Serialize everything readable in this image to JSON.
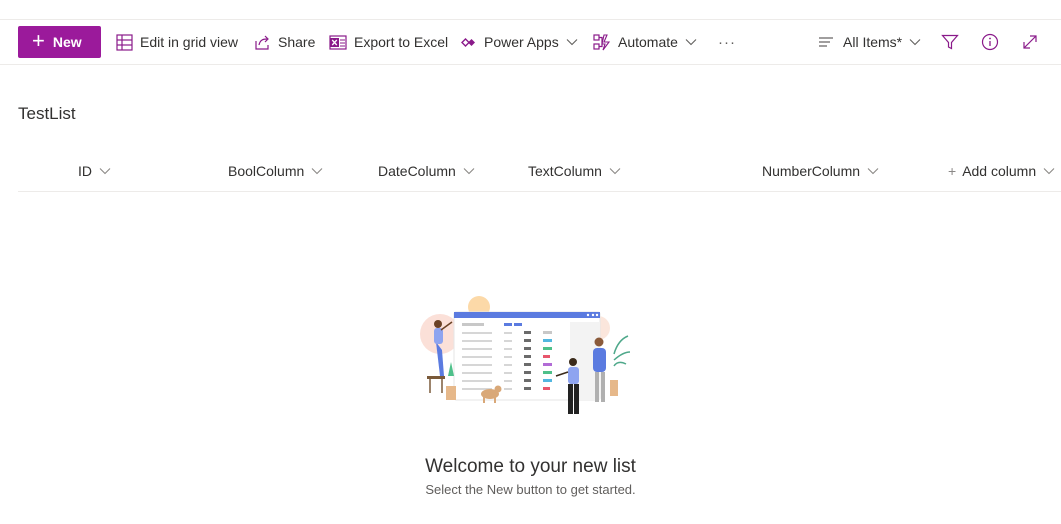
{
  "command_bar": {
    "new_label": "New",
    "edit_grid_label": "Edit in grid view",
    "share_label": "Share",
    "export_label": "Export to Excel",
    "power_apps_label": "Power Apps",
    "automate_label": "Automate",
    "more_label": "···",
    "view_label": "All Items*"
  },
  "list": {
    "title": "TestList",
    "columns": [
      "ID",
      "BoolColumn",
      "DateColumn",
      "TextColumn",
      "NumberColumn"
    ],
    "add_column_label": "Add column"
  },
  "empty_state": {
    "heading": "Welcome to your new list",
    "subtext": "Select the New button to get started."
  },
  "colors": {
    "accent": "#9b1a9b",
    "icon": "#7f1f7f"
  }
}
